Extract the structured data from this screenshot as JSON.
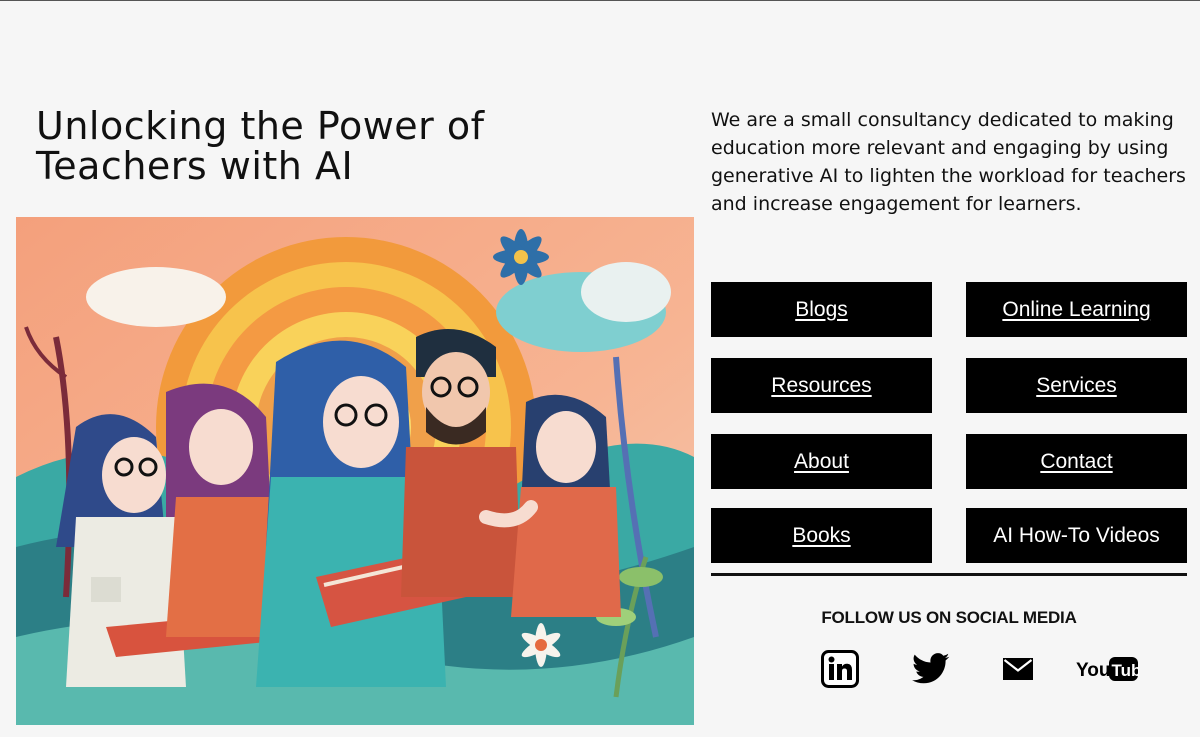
{
  "hero": {
    "title": "Unlocking the Power of Teachers with AI",
    "image_alt": "Paper-cut illustration of teachers and students reading books together"
  },
  "intro": {
    "text": "We are a small consultancy dedicated to making education more relevant and engaging by using generative AI to lighten the workload for teachers and increase engagement for learners."
  },
  "nav": {
    "blogs": "Blogs",
    "online_learning": "Online Learning",
    "resources": "Resources",
    "services": "Services",
    "about": "About",
    "contact": "Contact",
    "books": "Books",
    "ai_videos": "AI How-To Videos"
  },
  "social": {
    "heading": "FOLLOW US ON SOCIAL MEDIA",
    "icons": [
      "linkedin-icon",
      "twitter-icon",
      "email-icon",
      "youtube-icon"
    ]
  },
  "colors": {
    "background": "#f6f6f6",
    "button": "#000000",
    "button_text": "#ffffff"
  }
}
